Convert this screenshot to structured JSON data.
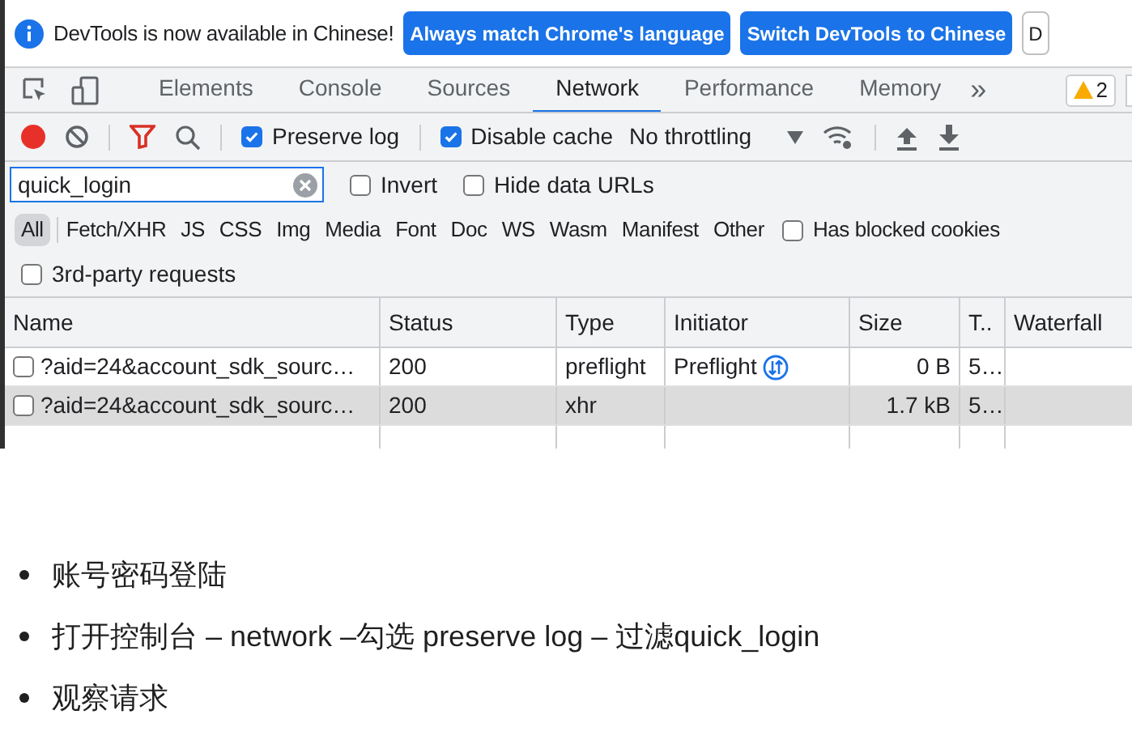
{
  "infobar": {
    "message": "DevTools is now available in Chinese!",
    "buttons": [
      "Always match Chrome's language",
      "Switch DevTools to Chinese",
      "D"
    ]
  },
  "tabs": [
    {
      "label": "Elements",
      "selected": false
    },
    {
      "label": "Console",
      "selected": false
    },
    {
      "label": "Sources",
      "selected": false
    },
    {
      "label": "Network",
      "selected": true
    },
    {
      "label": "Performance",
      "selected": false
    },
    {
      "label": "Memory",
      "selected": false
    }
  ],
  "more_tabs": "»",
  "warning_count": "2",
  "toolbar": {
    "recording": true,
    "preserve_log": {
      "label": "Preserve log",
      "checked": true
    },
    "disable_cache": {
      "label": "Disable cache",
      "checked": true
    },
    "throttling": "No throttling"
  },
  "filter": {
    "value": "quick_login",
    "invert": {
      "label": "Invert",
      "checked": false
    },
    "hide_data_urls": {
      "label": "Hide data URLs",
      "checked": false
    }
  },
  "types": [
    {
      "label": "All",
      "selected": true
    },
    {
      "label": "Fetch/XHR",
      "selected": false
    },
    {
      "label": "JS",
      "selected": false
    },
    {
      "label": "CSS",
      "selected": false
    },
    {
      "label": "Img",
      "selected": false
    },
    {
      "label": "Media",
      "selected": false
    },
    {
      "label": "Font",
      "selected": false
    },
    {
      "label": "Doc",
      "selected": false
    },
    {
      "label": "WS",
      "selected": false
    },
    {
      "label": "Wasm",
      "selected": false
    },
    {
      "label": "Manifest",
      "selected": false
    },
    {
      "label": "Other",
      "selected": false
    }
  ],
  "has_blocked_cookies": {
    "label": "Has blocked cookies",
    "checked": false
  },
  "third_party": {
    "label": "3rd-party requests",
    "checked": false
  },
  "table": {
    "columns": [
      "Name",
      "Status",
      "Type",
      "Initiator",
      "Size",
      "T..",
      "Waterfall"
    ],
    "rows": [
      {
        "name": "?aid=24&account_sdk_sourc…",
        "status": "200",
        "type": "preflight",
        "initiator": "Preflight",
        "preflight_icon": true,
        "size": "0 B",
        "time": "5…",
        "selected": false
      },
      {
        "name": "?aid=24&account_sdk_sourc…",
        "status": "200",
        "type": "xhr",
        "initiator": "",
        "preflight_icon": false,
        "size": "1.7 kB",
        "time": "5…",
        "selected": true
      }
    ]
  },
  "bullets": [
    "账号密码登陆",
    "打开控制台 – network –勾选 preserve log – 过滤quick_login",
    "观察请求"
  ]
}
